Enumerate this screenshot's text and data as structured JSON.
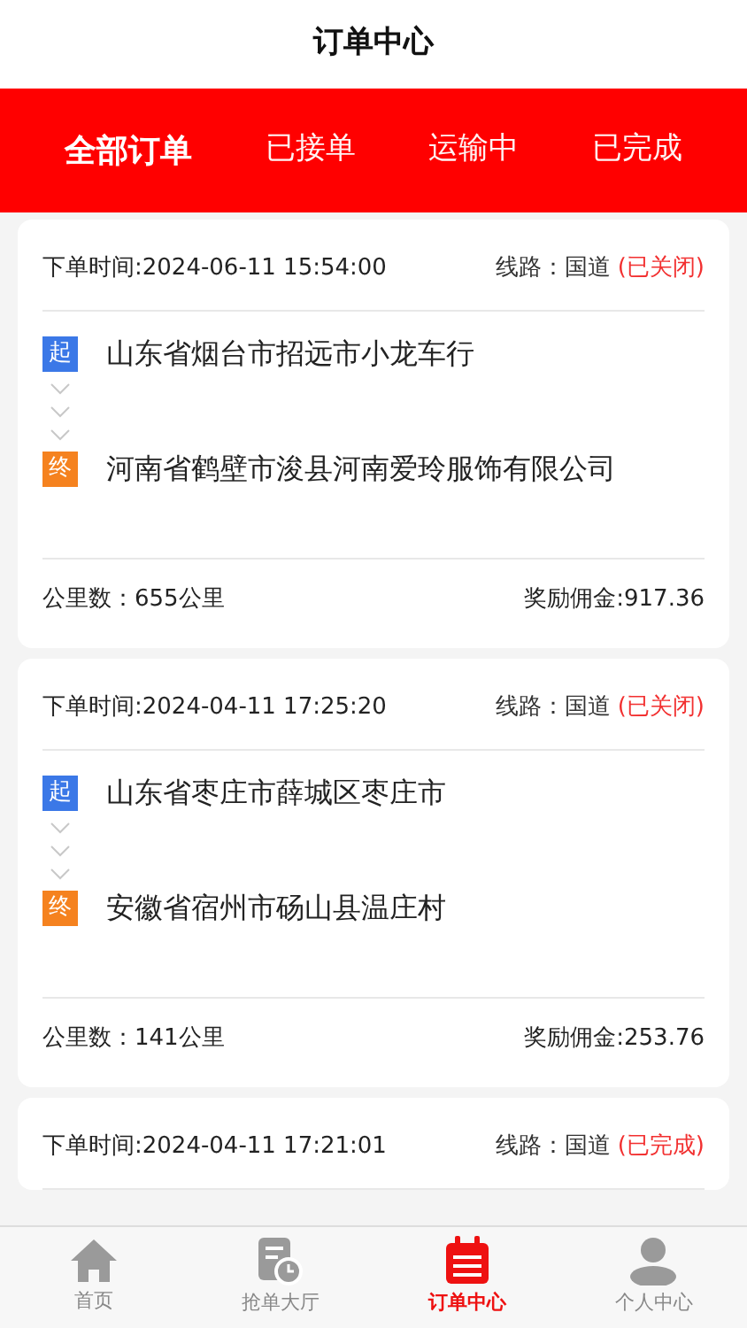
{
  "header": {
    "title": "订单中心"
  },
  "tabs": [
    {
      "label": "全部订单",
      "selected": true
    },
    {
      "label": "已接单",
      "selected": false
    },
    {
      "label": "运输中",
      "selected": false
    },
    {
      "label": "已完成",
      "selected": false
    }
  ],
  "orders": [
    {
      "time": "下单时间:2024-06-11 15:54:00",
      "route": "线路：国道",
      "status": "(已关闭)",
      "start_badge": "起",
      "start": "山东省烟台市招远市小龙车行",
      "end_badge": "终",
      "end": "河南省鹤壁市浚县河南爱玲服饰有限公司",
      "distance": "公里数：655公里",
      "commission": "奖励佣金:917.36"
    },
    {
      "time": "下单时间:2024-04-11 17:25:20",
      "route": "线路：国道",
      "status": "(已关闭)",
      "start_badge": "起",
      "start": "山东省枣庄市薛城区枣庄市",
      "end_badge": "终",
      "end": "安徽省宿州市砀山县温庄村",
      "distance": "公里数：141公里",
      "commission": "奖励佣金:253.76"
    },
    {
      "time": "下单时间:2024-04-11 17:21:01",
      "route": "线路：国道",
      "status": "(已完成)"
    }
  ],
  "nav": [
    {
      "label": "首页",
      "kind": "home",
      "selected": false
    },
    {
      "label": "抢单大厅",
      "kind": "hall",
      "selected": false
    },
    {
      "label": "订单中心",
      "kind": "orders",
      "selected": true
    },
    {
      "label": "个人中心",
      "kind": "profile",
      "selected": false
    }
  ]
}
